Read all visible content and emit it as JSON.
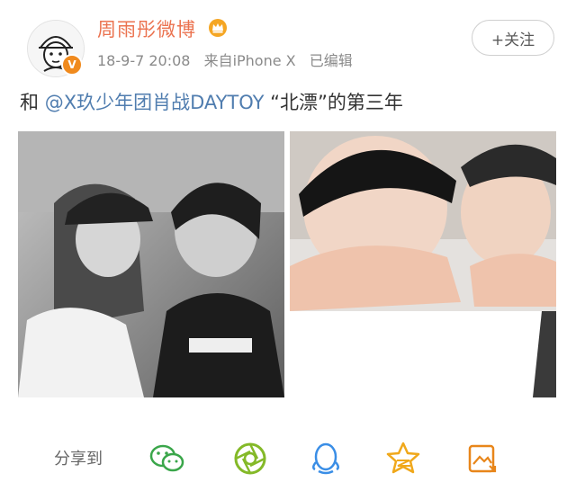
{
  "post": {
    "username": "周雨彤微博",
    "verified_badge": "V",
    "timestamp": "18-9-7 20:08",
    "source": "来自iPhone X",
    "edited": "已编辑",
    "follow_label": "+关注",
    "text_prefix": "和 ",
    "mention": "@X玖少年团肖战DAYTOY",
    "text_suffix": " “北漂”的第三年",
    "images": [
      {
        "kind": "photo",
        "tone": "grayscale",
        "alt_icon": "photo-icon"
      },
      {
        "kind": "photo",
        "tone": "color",
        "alt_icon": "photo-icon"
      }
    ]
  },
  "share": {
    "label": "分享到",
    "targets": [
      {
        "name": "wechat",
        "icon": "wechat-icon",
        "color": "#3aa64a"
      },
      {
        "name": "moments",
        "icon": "moments-icon",
        "color": "#84b928"
      },
      {
        "name": "qq",
        "icon": "qq-icon",
        "color": "#3a8ee6"
      },
      {
        "name": "qzone",
        "icon": "qzone-icon",
        "color": "#f0a81b"
      },
      {
        "name": "weibo-story",
        "icon": "image-share-icon",
        "color": "#e8861a"
      }
    ]
  },
  "colors": {
    "username": "#eb7350",
    "mention": "#507daf",
    "meta": "#8a8a8a",
    "badge": "#f08a1d"
  }
}
